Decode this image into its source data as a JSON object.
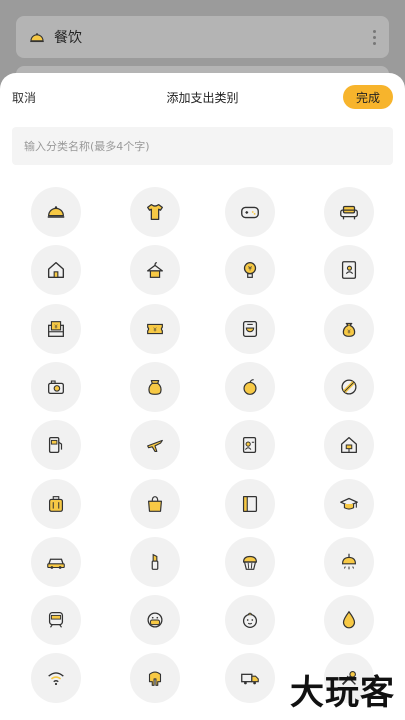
{
  "background": {
    "first_item_label": "餐饮"
  },
  "sheet": {
    "cancel_label": "取消",
    "title": "添加支出类别",
    "done_label": "完成",
    "input_placeholder": "输入分类名称(最多4个字)"
  },
  "colors": {
    "accent": "#f7b42c",
    "icon_bg": "#f1f1f1",
    "icon_fill": "#f7c945",
    "icon_stroke": "#333333"
  },
  "icons": [
    "cloche-icon",
    "tshirt-icon",
    "gamepad-icon",
    "sofa-icon",
    "house-icon",
    "hanger-icon",
    "lightbulb-icon",
    "contacts-book-icon",
    "yen-box-icon",
    "ticket-icon",
    "floppy-bag-icon",
    "money-bag-icon",
    "camera-icon",
    "gift-bag-icon",
    "apple-icon",
    "ball-icon",
    "fuel-pump-icon",
    "airplane-icon",
    "id-card-icon",
    "home-renovation-icon",
    "suitcase-icon",
    "shopping-bag-icon",
    "book-icon",
    "graduation-cap-icon",
    "car-icon",
    "lipstick-icon",
    "cupcake-icon",
    "ceiling-lamp-icon",
    "train-icon",
    "face-mask-icon",
    "baby-face-icon",
    "water-drop-icon",
    "wifi-icon",
    "elephant-icon",
    "truck-icon",
    "tools-icon"
  ],
  "watermark": "大玩客"
}
